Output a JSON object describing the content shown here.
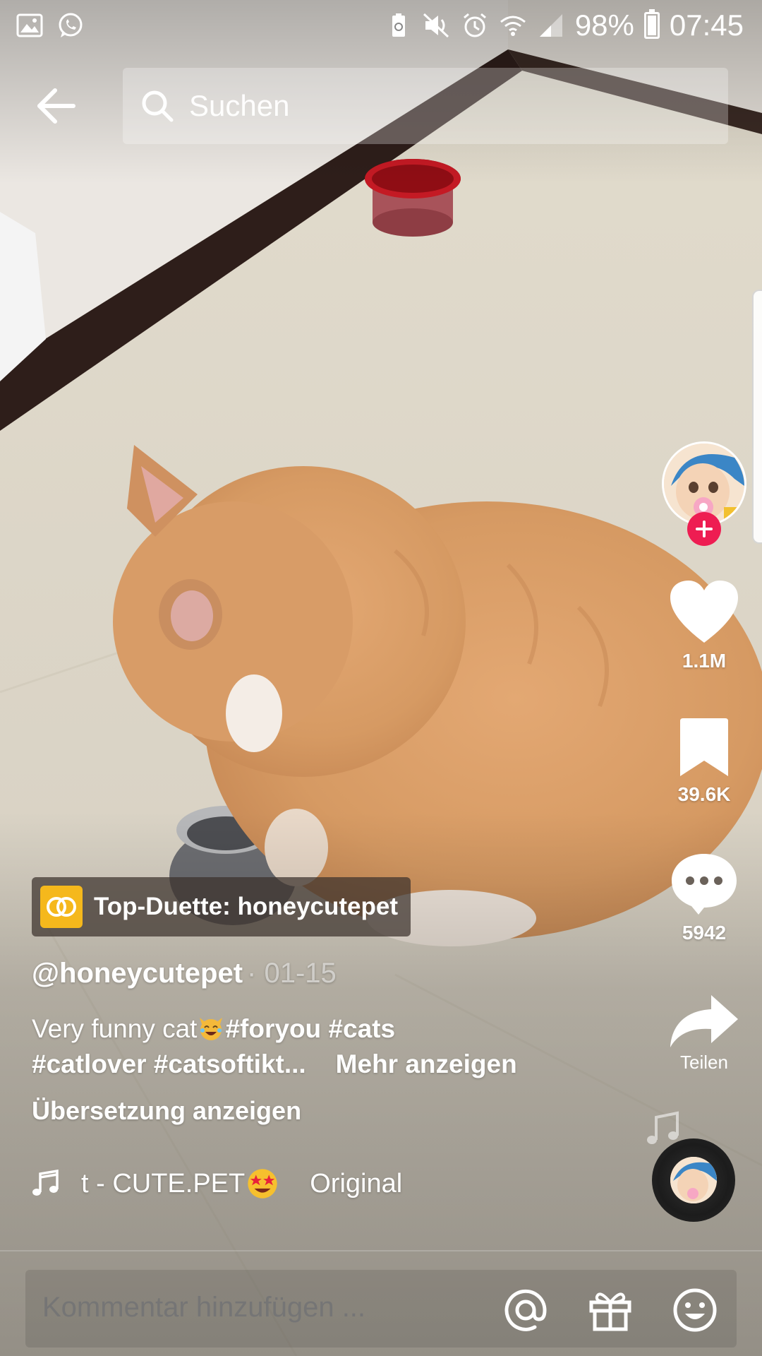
{
  "status_bar": {
    "battery": "98%",
    "time": "07:45",
    "left_icons": [
      "gallery-icon",
      "whatsapp-icon"
    ],
    "right_icons": [
      "battery-saver-icon",
      "mute-icon",
      "alarm-icon",
      "wifi-icon",
      "signal-icon"
    ]
  },
  "search": {
    "placeholder": "Suchen"
  },
  "rail": {
    "likes": "1.1M",
    "saves": "39.6K",
    "comments": "5942",
    "share_label": "Teilen"
  },
  "video": {
    "duet_badge": "Top-Duette: honeycutepet",
    "username": "@honeycutepet",
    "date": "· 01-15",
    "caption_text": "Very funny cat",
    "caption_tag_line1": "#foryou #cats",
    "caption_tag_line2": "#catlover #catsoftikt...",
    "more_label": "Mehr anzeigen",
    "translate_label": "Übersetzung anzeigen",
    "music_title": "t - CUTE.PET",
    "music_original": "Original"
  },
  "comment_bar": {
    "placeholder": "Kommentar hinzufügen ..."
  },
  "colors": {
    "accent_red": "#ee1d52",
    "duet_yellow": "#f5b81c"
  }
}
